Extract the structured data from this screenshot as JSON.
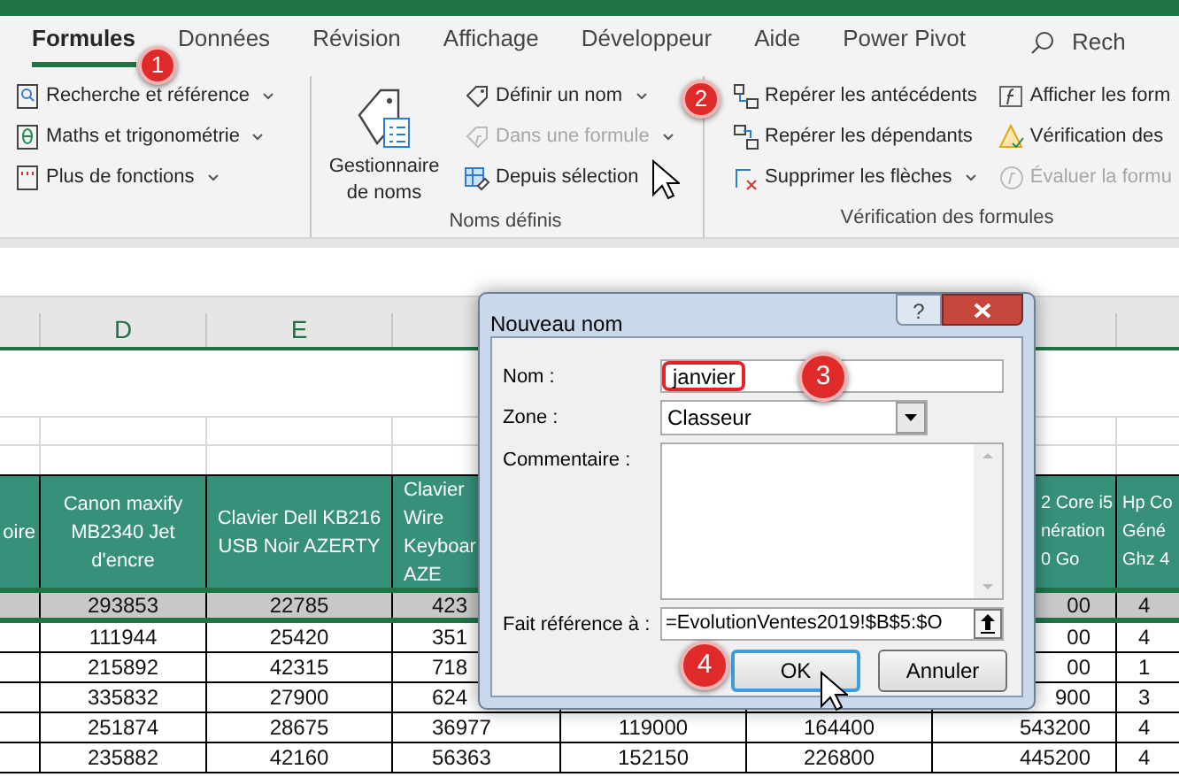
{
  "tabs": [
    {
      "label": "Formules",
      "selected": true
    },
    {
      "label": "Données",
      "selected": false
    },
    {
      "label": "Révision",
      "selected": false
    },
    {
      "label": "Affichage",
      "selected": false
    },
    {
      "label": "Développeur",
      "selected": false
    },
    {
      "label": "Aide",
      "selected": false
    },
    {
      "label": "Power Pivot",
      "selected": false
    }
  ],
  "search": {
    "label": "Rech"
  },
  "ribbon": {
    "groups": [
      {
        "items": [
          {
            "label": "Recherche et référence",
            "dropdown": true,
            "disabled": false
          },
          {
            "label": "Maths et trigonométrie",
            "dropdown": true,
            "disabled": false
          },
          {
            "label": "Plus de fonctions",
            "dropdown": true,
            "disabled": false
          }
        ]
      },
      {
        "title": "Noms définis",
        "large_button": {
          "label": "Gestionnaire\nde noms"
        },
        "items": [
          {
            "label": "Définir un nom",
            "dropdown": true,
            "disabled": false
          },
          {
            "label": "Dans une formule",
            "dropdown": true,
            "disabled": true
          },
          {
            "label": "Depuis sélection",
            "dropdown": false,
            "disabled": false
          }
        ]
      },
      {
        "title": "Vérification des formules",
        "items": [
          {
            "label": "Repérer les antécédents",
            "dropdown": false,
            "disabled": false
          },
          {
            "label": "Repérer les dépendants",
            "dropdown": false,
            "disabled": false
          },
          {
            "label": "Supprimer les flèches",
            "dropdown": true,
            "disabled": false
          },
          {
            "label": "Afficher les form",
            "dropdown": false,
            "disabled": false
          },
          {
            "label": "Vérification des",
            "dropdown": false,
            "disabled": false
          },
          {
            "label": "Évaluer la formu",
            "dropdown": false,
            "disabled": true
          }
        ]
      }
    ]
  },
  "spreadsheet": {
    "columns": [
      {
        "header": "oire"
      },
      {
        "letter": "D",
        "header": "Canon maxify\nMB2340 Jet\nd'encre"
      },
      {
        "letter": "E",
        "header": "Clavier Dell KB216\nUSB Noir AZERTY"
      },
      {
        "header": "Clavier\nWire\nKeyboar\nAZE"
      },
      {},
      {},
      {
        "header": "2 Core i5\nnération\n0 Go"
      },
      {
        "header": "Hp Co\nGéné\nGhz 4"
      }
    ],
    "rows": [
      {
        "selected": true,
        "cells": [
          null,
          "293853",
          "22785",
          "423",
          null,
          null,
          "00",
          "4"
        ]
      },
      {
        "selected": false,
        "cells": [
          null,
          "111944",
          "25420",
          "351",
          null,
          null,
          "00",
          "4"
        ]
      },
      {
        "selected": false,
        "cells": [
          null,
          "215892",
          "42315",
          "718",
          null,
          null,
          "00",
          "1"
        ]
      },
      {
        "selected": false,
        "cells": [
          null,
          "335832",
          "27900",
          "624",
          null,
          null,
          "900",
          "3"
        ]
      },
      {
        "selected": false,
        "cells": [
          null,
          "251874",
          "28675",
          "36977",
          "119000",
          "164400",
          "543200",
          "4"
        ]
      },
      {
        "selected": false,
        "cells": [
          null,
          "235882",
          "42160",
          "56363",
          "152150",
          "226800",
          "445200",
          "4"
        ]
      }
    ]
  },
  "dialog": {
    "title": "Nouveau nom",
    "help_button": "?",
    "fields": [
      {
        "kind": "text",
        "label": "Nom :",
        "value": "janvier"
      },
      {
        "kind": "select",
        "label": "Zone :",
        "value": "Classeur"
      },
      {
        "kind": "textarea",
        "label": "Commentaire :"
      },
      {
        "kind": "reference",
        "label": "Fait référence à :",
        "value": "=EvolutionVentes2019!$B$5:$O"
      }
    ],
    "buttons": [
      {
        "label": "OK",
        "default": true
      },
      {
        "label": "Annuler",
        "default": false
      }
    ]
  },
  "callouts": [
    "1",
    "2",
    "3",
    "4"
  ]
}
